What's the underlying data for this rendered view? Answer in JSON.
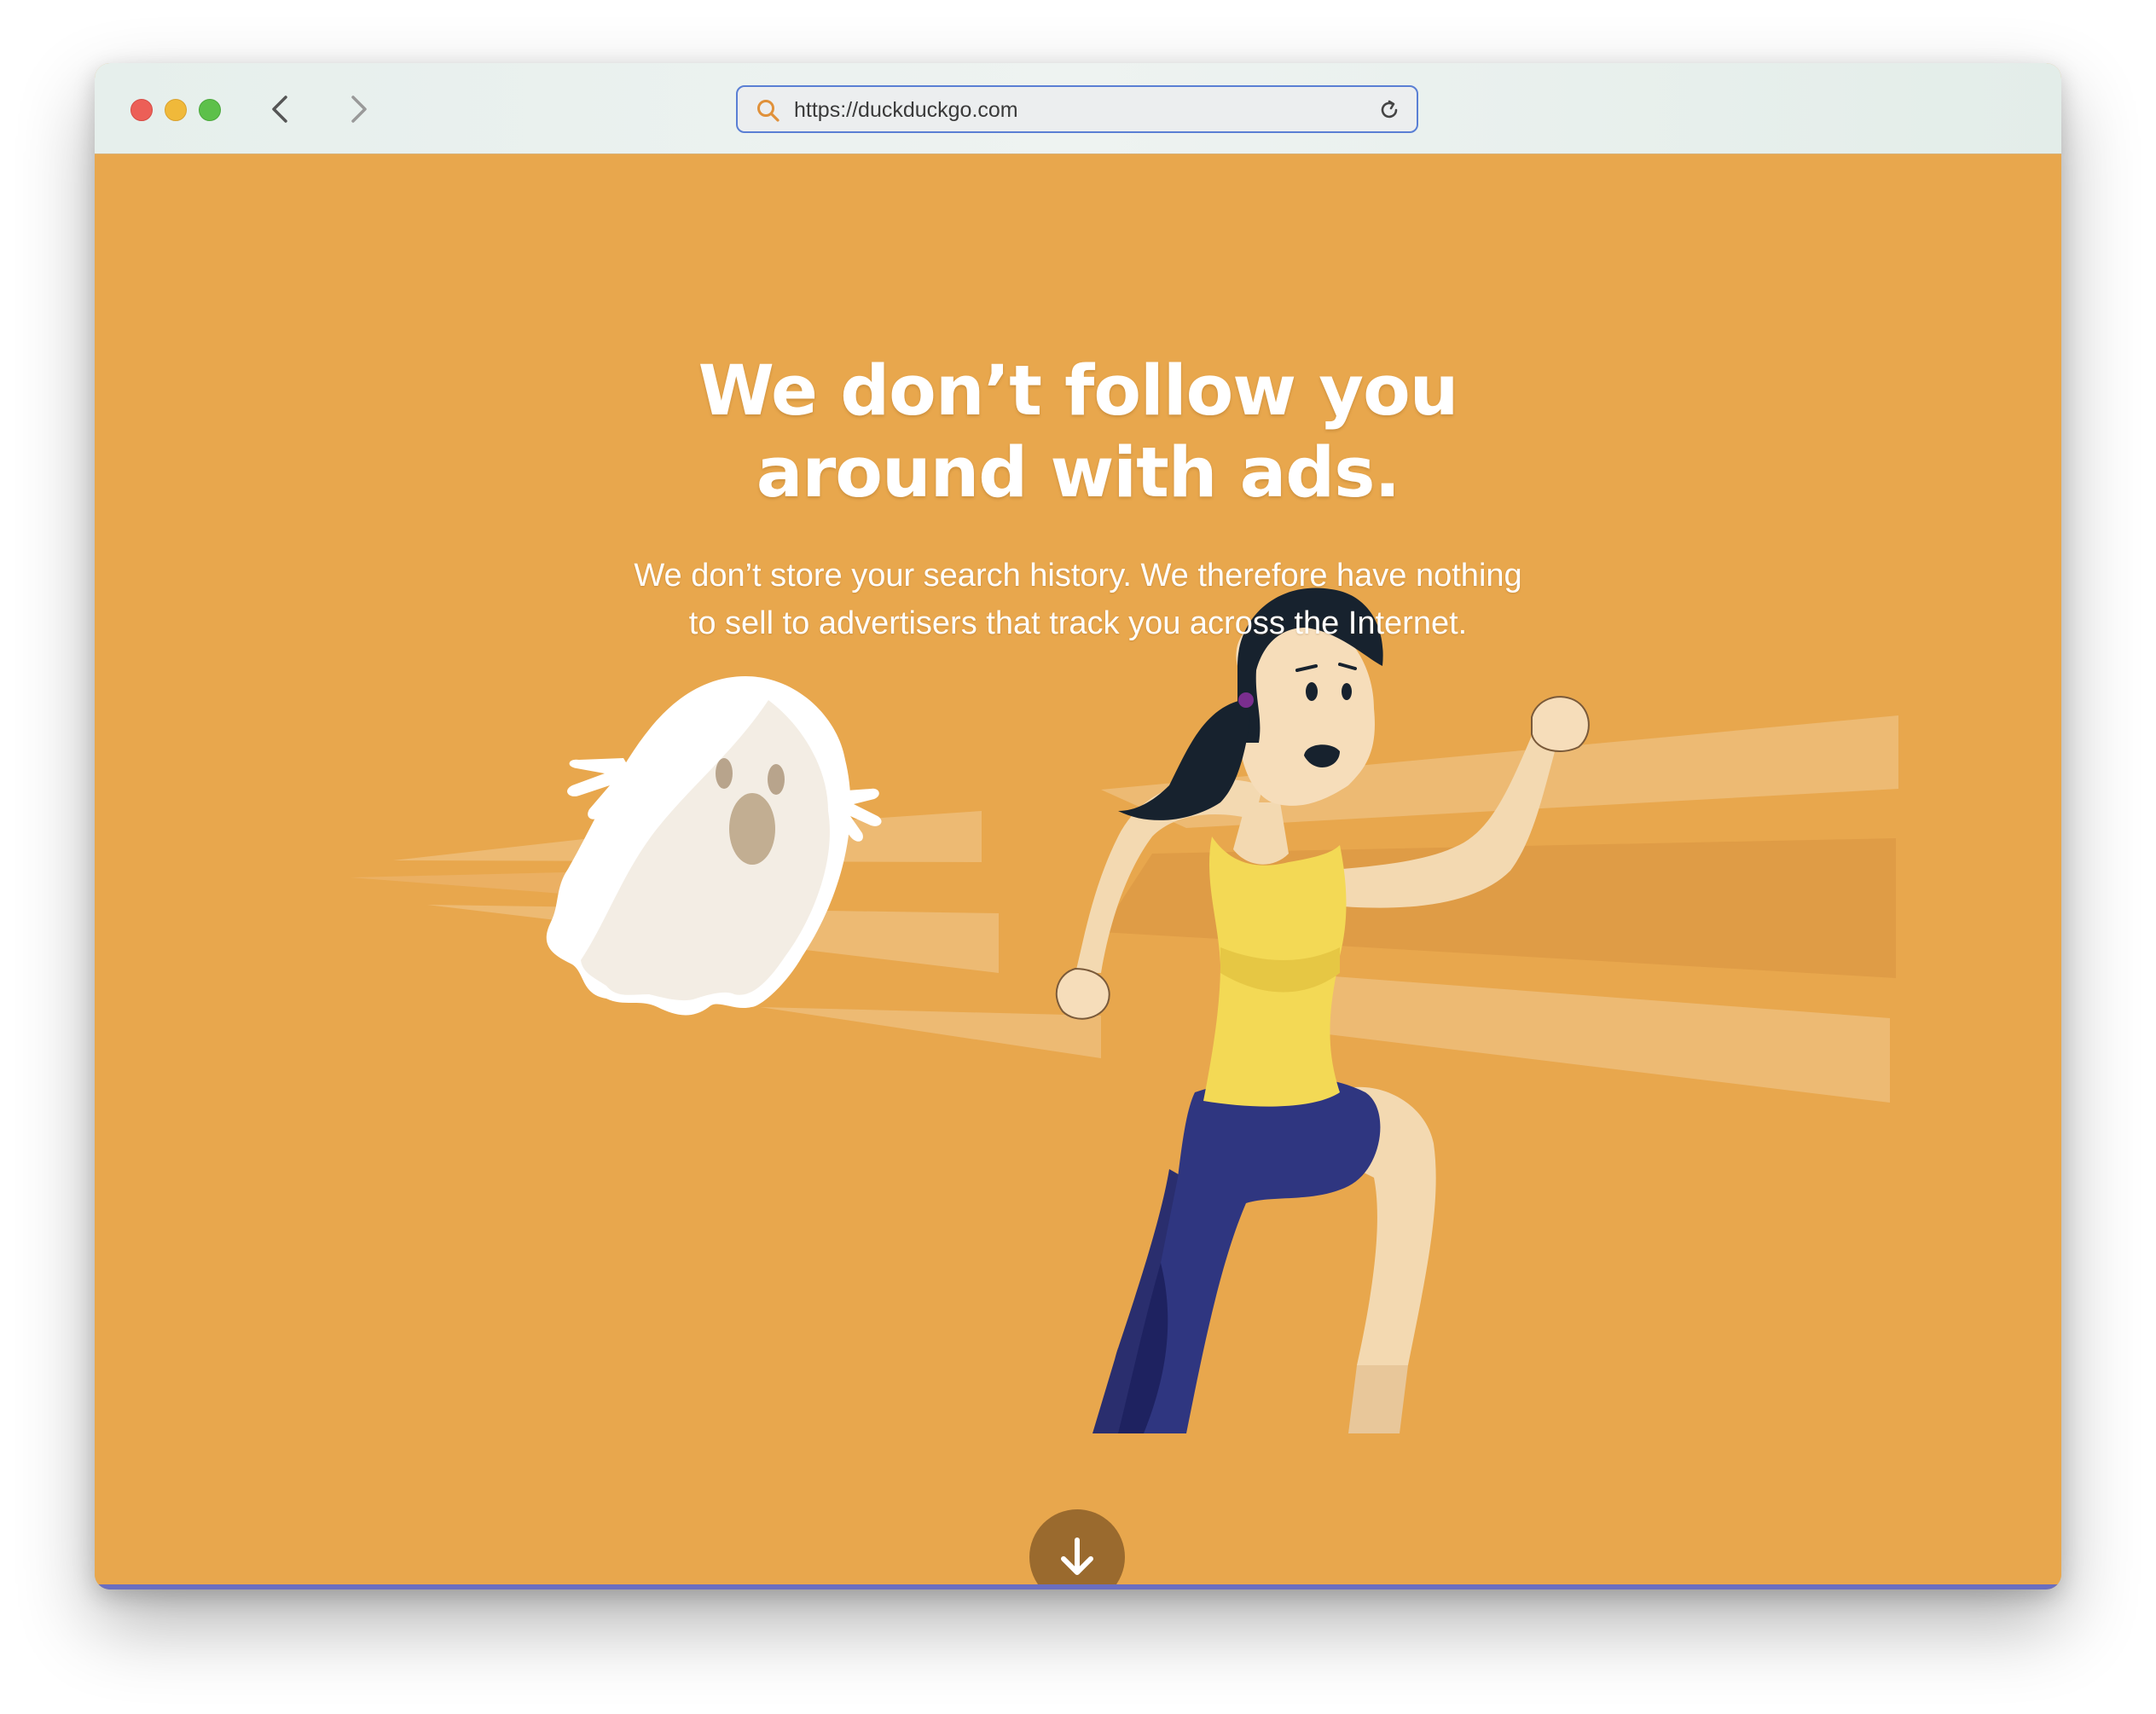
{
  "browser": {
    "url": "https://duckduckgo.com",
    "back_icon": "chevron-left-icon",
    "forward_icon": "chevron-right-icon",
    "search_icon": "search-icon",
    "reload_icon": "reload-icon"
  },
  "hero": {
    "headline_line1": "We don’t follow you",
    "headline_line2": "around with ads.",
    "subline_line1": "We don’t store your search history. We therefore have nothing",
    "subline_line2": "to sell to advertisers that track you across the Internet."
  },
  "illustration": {
    "subjects": [
      "ghost",
      "running-woman"
    ]
  },
  "scroll_button": {
    "icon": "arrow-down-icon"
  },
  "colors": {
    "background": "#E8A74D",
    "accent_url_border": "#5a7fd4",
    "scroll_button": "#9a6a2e",
    "bottom_line": "#6a6ec0"
  }
}
